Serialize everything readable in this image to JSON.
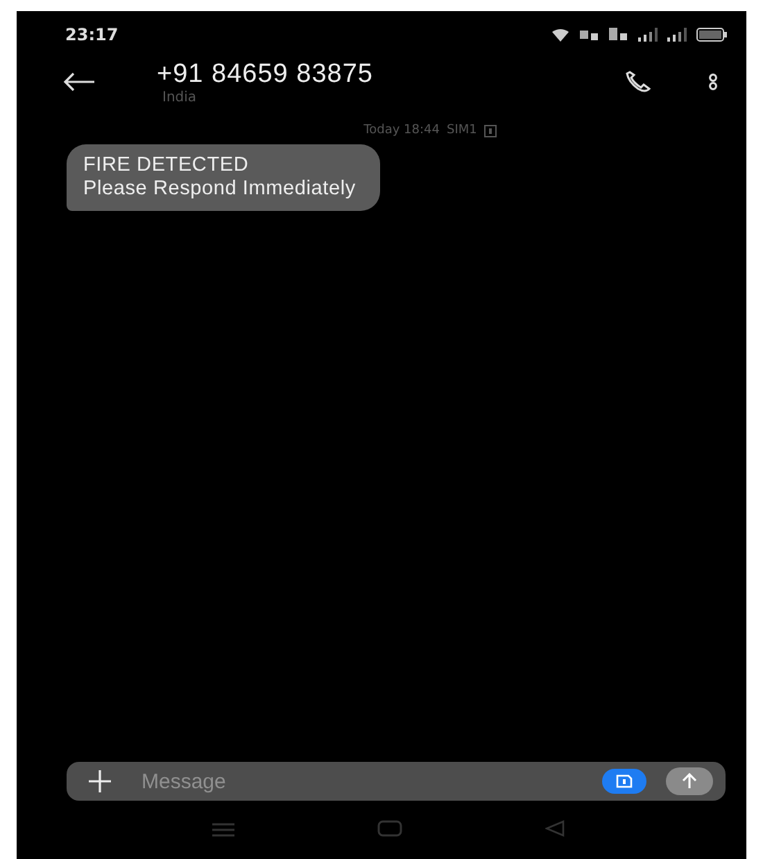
{
  "status_bar": {
    "time": "23:17"
  },
  "header": {
    "title": "+91 84659 83875",
    "subtitle": "India"
  },
  "messages": [
    {
      "timestamp": "Today 18:44",
      "sim": "SIM1",
      "text": "FIRE DETECTED\nPlease Respond Immediately"
    }
  ],
  "composer": {
    "placeholder": "Message"
  }
}
